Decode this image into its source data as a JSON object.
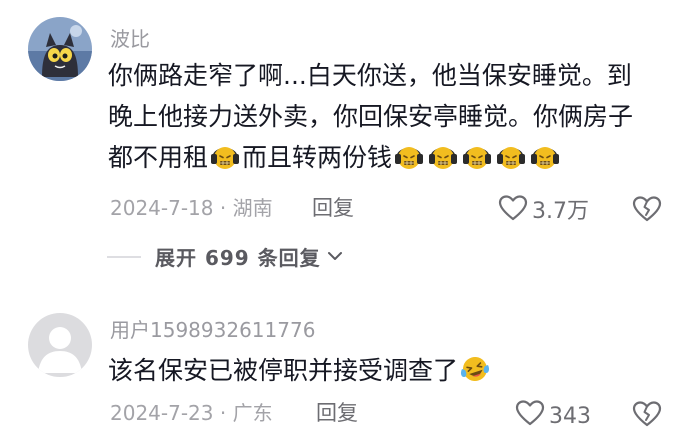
{
  "comments": [
    {
      "username": "波比",
      "lines": [
        "你俩路走窄了啊...白天你送，他当保安睡觉。到",
        "晚上他接力送外卖，你回保安亭睡觉。你俩房子",
        "都不用租",
        "而且转两份钱"
      ],
      "emoji_name": "headphones-grimace-emoji",
      "date_location": "2024-7-18 · 湖南",
      "reply_label": "回复",
      "likes": "3.7万",
      "expand_label": "展开 699 条回复"
    },
    {
      "username": "用户1598932611776",
      "text": "该名保安已被停职并接受调查了",
      "emoji_name": "laughing-tears-emoji",
      "date_location": "2024-7-23 · 广东",
      "reply_label": "回复",
      "likes": "343"
    }
  ],
  "colors": {
    "username": "#9a9aa0",
    "text": "#161823",
    "meta": "#a3a3a8",
    "accent_emoji": "#f2bd1f"
  }
}
